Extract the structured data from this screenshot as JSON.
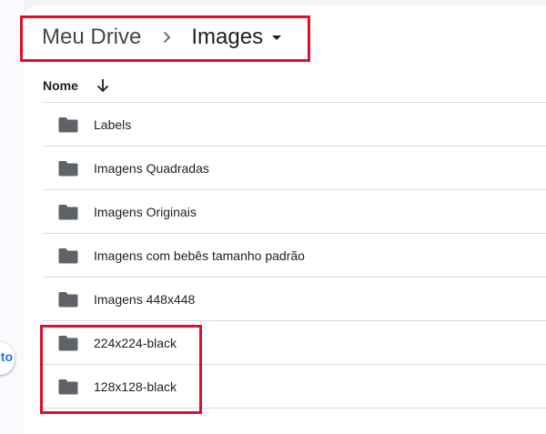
{
  "breadcrumb": {
    "root": "Meu Drive",
    "current": "Images"
  },
  "list_header": {
    "name_label": "Nome",
    "sort_icon": "arrow-down-icon"
  },
  "side_button": {
    "text": "to"
  },
  "folders": [
    {
      "label": "Labels"
    },
    {
      "label": "Imagens Quadradas"
    },
    {
      "label": "Imagens Originais"
    },
    {
      "label": "Imagens com bebês tamanho padrão"
    },
    {
      "label": "Imagens 448x448"
    },
    {
      "label": "224x224-black"
    },
    {
      "label": "128x128-black"
    }
  ],
  "colors": {
    "highlight": "#e0102a",
    "folder": "#5f6368",
    "accent": "#1a73e8"
  }
}
